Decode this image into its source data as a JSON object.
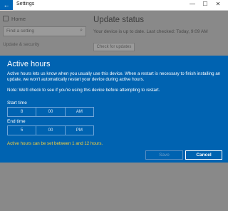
{
  "window": {
    "title": "Settings",
    "back_glyph": "←",
    "minimize": "—",
    "maximize": "☐",
    "close": "✕"
  },
  "sidebar": {
    "home_label": "Home",
    "find_placeholder": "Find a setting",
    "search_icon": "⌕",
    "category": "Update & security"
  },
  "main": {
    "title": "Update status",
    "status": "Your device is up to date. Last checked: Today, 9:09 AM",
    "check_button": "Check for updates"
  },
  "dialog": {
    "title": "Active hours",
    "description": "Active hours lets us know when you usually use this device. When a restart is necessary to finish installing an update, we won't automatically restart your device during active hours.",
    "note": "Note: We'll check to see if you're using this device before attempting to restart.",
    "start_label": "Start time",
    "start_hour": "8",
    "start_minute": "00",
    "start_ampm": "AM",
    "end_label": "End time",
    "end_hour": "5",
    "end_minute": "00",
    "end_ampm": "PM",
    "range_note": "Active hours can be set between 1 and 12 hours.",
    "save_label": "Save",
    "cancel_label": "Cancel"
  },
  "colors": {
    "accent": "#0063b1",
    "warning_text": "#f5d03b",
    "overlay": "#898989"
  }
}
